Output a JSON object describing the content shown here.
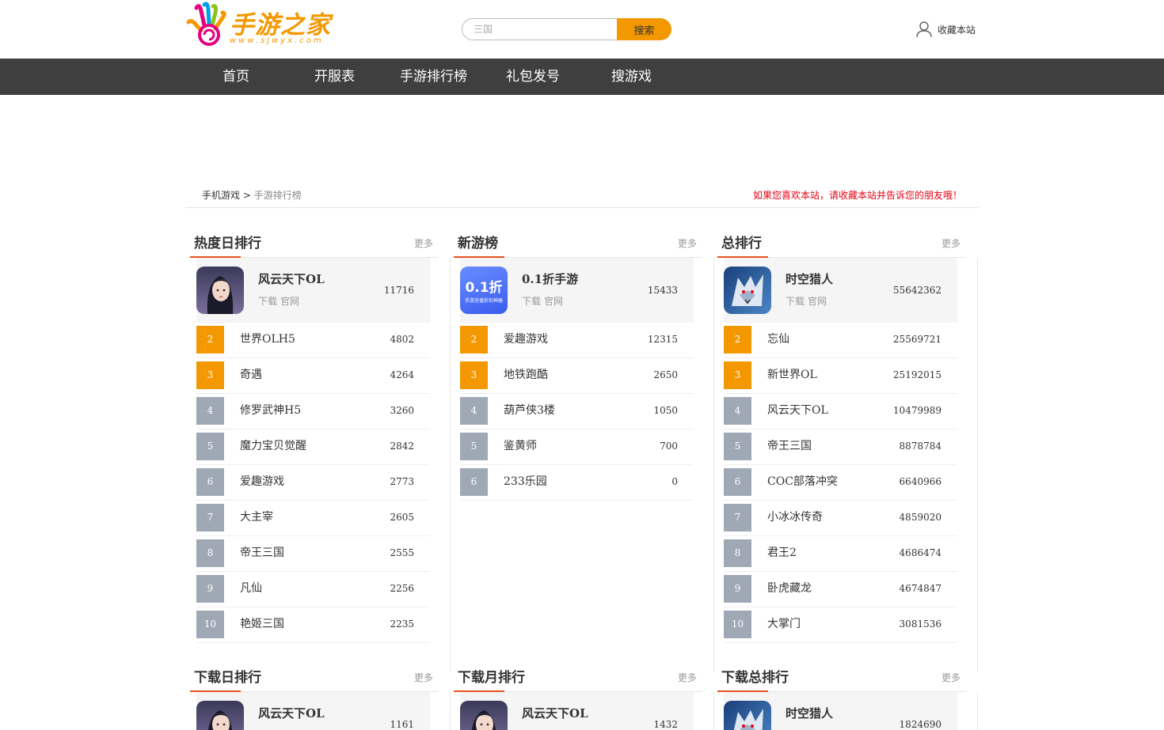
{
  "header": {
    "logo_text": "手游之家",
    "logo_url": "www.sjwyx.com",
    "search_placeholder": "三国",
    "search_button": "搜索",
    "favorite_label": "收藏本站"
  },
  "nav": {
    "items": [
      {
        "label": "首页"
      },
      {
        "label": "开服表"
      },
      {
        "label": "手游排行榜"
      },
      {
        "label": "礼包发号"
      },
      {
        "label": "搜游戏"
      }
    ]
  },
  "breadcrumb": {
    "home": "手机游戏",
    "separator": ">",
    "current": "手游排行榜",
    "notice": "如果您喜欢本站，请收藏本站并告诉您的朋友哦！"
  },
  "common": {
    "more": "更多",
    "download": "下载",
    "official": "官网"
  },
  "panels": [
    {
      "title": "热度日排行",
      "top": {
        "name": "风云天下OL",
        "count": "11716",
        "icon": "female-warrior"
      },
      "rows": [
        {
          "rank": "2",
          "name": "世界OLH5",
          "count": "4802"
        },
        {
          "rank": "3",
          "name": "奇遇",
          "count": "4264"
        },
        {
          "rank": "4",
          "name": "修罗武神H5",
          "count": "3260"
        },
        {
          "rank": "5",
          "name": "魔力宝贝觉醒",
          "count": "2842"
        },
        {
          "rank": "6",
          "name": "爱趣游戏",
          "count": "2773"
        },
        {
          "rank": "7",
          "name": "大主宰",
          "count": "2605"
        },
        {
          "rank": "8",
          "name": "帝王三国",
          "count": "2555"
        },
        {
          "rank": "9",
          "name": "凡仙",
          "count": "2256"
        },
        {
          "rank": "10",
          "name": "艳姬三国",
          "count": "2235"
        }
      ]
    },
    {
      "title": "新游榜",
      "top": {
        "name": "0.1折手游",
        "count": "15433",
        "icon": "discount-app",
        "icon_text": "0.1折",
        "icon_sub": "手游充值折扣神器"
      },
      "rows": [
        {
          "rank": "2",
          "name": "爱趣游戏",
          "count": "12315"
        },
        {
          "rank": "3",
          "name": "地铁跑酷",
          "count": "2650"
        },
        {
          "rank": "4",
          "name": "葫芦侠3楼",
          "count": "1050"
        },
        {
          "rank": "5",
          "name": "鉴黄师",
          "count": "700"
        },
        {
          "rank": "6",
          "name": "233乐园",
          "count": "0"
        }
      ]
    },
    {
      "title": "总排行",
      "top": {
        "name": "时空猎人",
        "count": "55642362",
        "icon": "wolf-warrior"
      },
      "rows": [
        {
          "rank": "2",
          "name": "忘仙",
          "count": "25569721"
        },
        {
          "rank": "3",
          "name": "新世界OL",
          "count": "25192015"
        },
        {
          "rank": "4",
          "name": "风云天下OL",
          "count": "10479989"
        },
        {
          "rank": "5",
          "name": "帝王三国",
          "count": "8878784"
        },
        {
          "rank": "6",
          "name": "COC部落冲突",
          "count": "6640966"
        },
        {
          "rank": "7",
          "name": "小冰冰传奇",
          "count": "4859020"
        },
        {
          "rank": "8",
          "name": "君王2",
          "count": "4686474"
        },
        {
          "rank": "9",
          "name": "卧虎藏龙",
          "count": "4674847"
        },
        {
          "rank": "10",
          "name": "大掌门",
          "count": "3081536"
        }
      ]
    },
    {
      "title": "下载日排行",
      "top": {
        "name": "风云天下OL",
        "count": "1161",
        "icon": "female-warrior"
      },
      "rows": []
    },
    {
      "title": "下载月排行",
      "top": {
        "name": "风云天下OL",
        "count": "1432",
        "icon": "female-warrior"
      },
      "rows": []
    },
    {
      "title": "下载总排行",
      "top": {
        "name": "时空猎人",
        "count": "1824690",
        "icon": "wolf-warrior"
      },
      "rows": []
    }
  ],
  "colors": {
    "accent": "#f39800",
    "nav_bg": "#3f3f3f",
    "title_underline": "#e8501e",
    "notice": "#e60012",
    "rank_cold": "#9fa9b6"
  }
}
